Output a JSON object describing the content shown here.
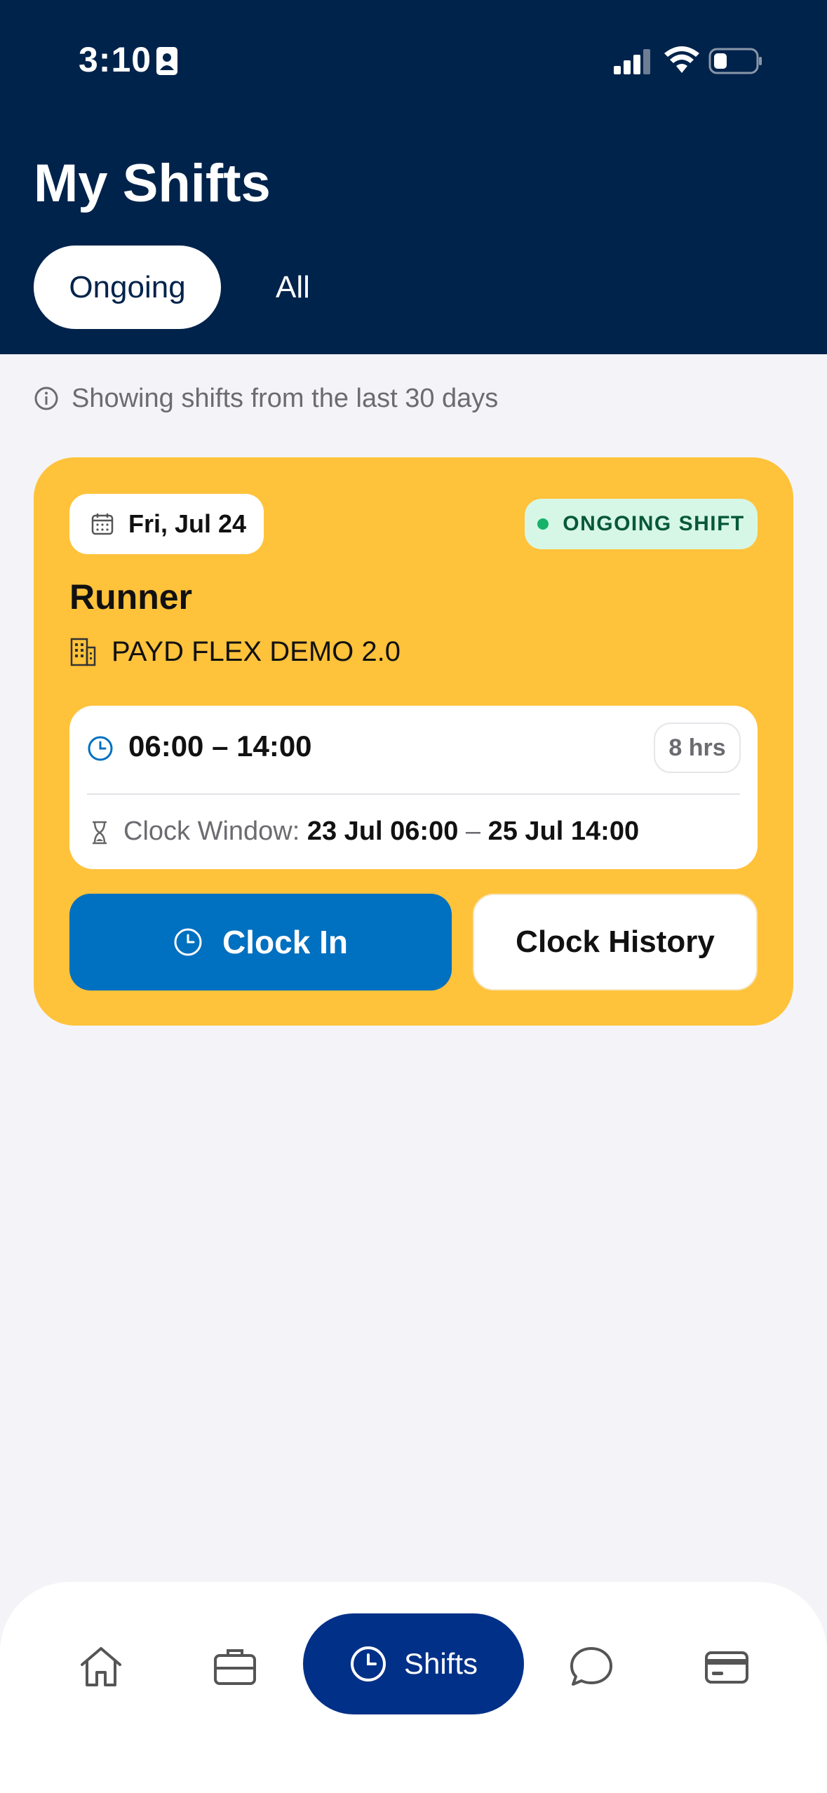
{
  "status_bar": {
    "time": "3:10",
    "icons": [
      "contact-card-icon",
      "cellular-signal-icon",
      "wifi-icon",
      "battery-icon"
    ]
  },
  "header": {
    "title": "My Shifts",
    "tabs": [
      {
        "label": "Ongoing",
        "active": true
      },
      {
        "label": "All",
        "active": false
      }
    ]
  },
  "info": {
    "text": "Showing shifts from the last 30 days",
    "icon": "info-icon"
  },
  "shift_card": {
    "date": "Fri, Jul 24",
    "status": "ONGOING SHIFT",
    "role": "Runner",
    "company": "PAYD FLEX DEMO 2.0",
    "time_range": "06:00 – 14:00",
    "hours": "8 hrs",
    "clock_window_label": "Clock Window:",
    "clock_window_start": "23 Jul 06:00",
    "clock_window_sep": "–",
    "clock_window_end": "25 Jul 14:00",
    "clock_in_label": "Clock In",
    "clock_history_label": "Clock History"
  },
  "bottom_nav": {
    "items": [
      {
        "icon": "home-icon"
      },
      {
        "icon": "briefcase-icon"
      },
      {
        "icon": "clock-icon",
        "label": "Shifts",
        "active": true
      },
      {
        "icon": "chat-bubble-icon"
      },
      {
        "icon": "credit-card-icon"
      }
    ]
  },
  "colors": {
    "header_bg": "#00234b",
    "card_bg": "#ffc23b",
    "primary_button": "#0070c0",
    "nav_active": "#003087",
    "status_badge_bg": "#d7f7e6",
    "status_dot": "#17b26a"
  }
}
